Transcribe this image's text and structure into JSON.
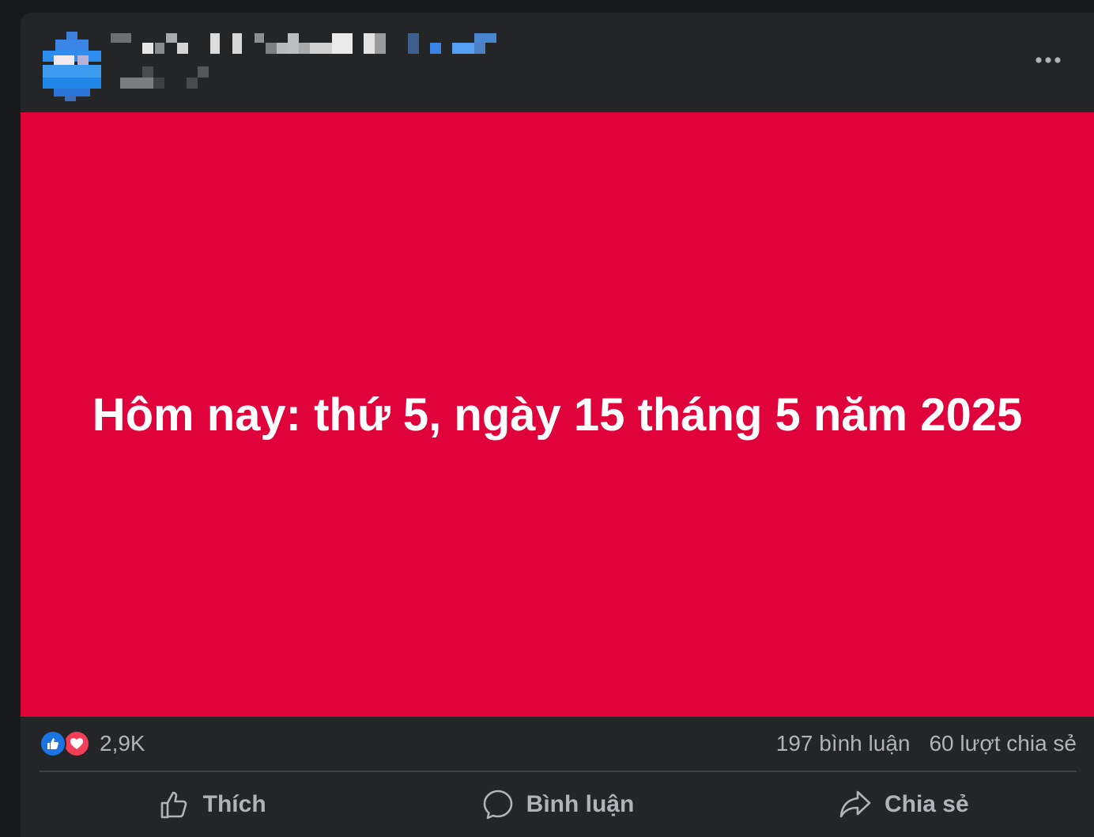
{
  "post": {
    "banner_text": "Hôm nay: thứ 5, ngày 15 tháng 5 năm 2025",
    "banner_color": "#e0023a",
    "reactions": {
      "icons": [
        "like-icon",
        "love-icon"
      ],
      "count": "2,9K"
    },
    "comments_count": "197 bình luận",
    "shares_count": "60 lượt chia sẻ",
    "actions": {
      "like_label": "Thích",
      "comment_label": "Bình luận",
      "share_label": "Chia sẻ"
    }
  },
  "colors": {
    "background": "#18191a",
    "card": "#242526",
    "secondary_text": "#b0b3b8",
    "like_blue": "#1b74e4",
    "love_red": "#f33e58"
  }
}
